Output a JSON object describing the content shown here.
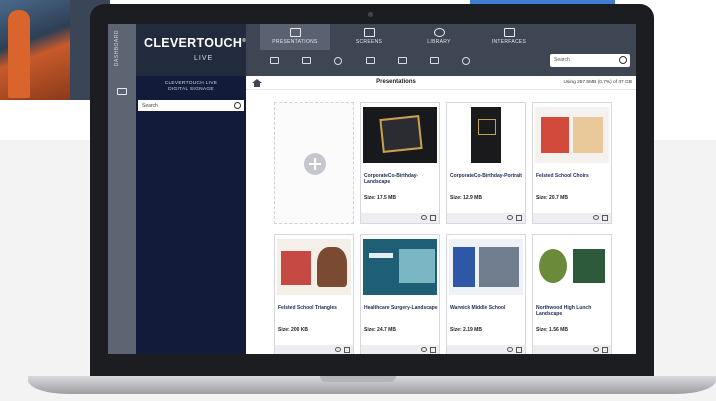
{
  "app": {
    "brand": "CLEVERTOUCH",
    "brand_mark": "®",
    "brand_sub": "LIVE",
    "vertical_label": "DASHBOARD"
  },
  "tabs": [
    {
      "label": "PRESENTATIONS",
      "active": true
    },
    {
      "label": "SCREENS",
      "active": false
    },
    {
      "label": "LIBRARY",
      "active": false
    },
    {
      "label": "INTERFACES",
      "active": false
    }
  ],
  "top_search": {
    "placeholder": "Search"
  },
  "panel": {
    "title_line1": "CLEVERTOUCH LIVE",
    "title_line2": "DIGITAL SIGNAGE",
    "search_placeholder": "Search"
  },
  "main": {
    "title": "Presentations",
    "usage": "Using 257.5MB (0.7%) of 37 GB"
  },
  "cards": [
    {
      "title": "CorporateCo-Birthday-Landscape",
      "size": "Size: 17.5 MB",
      "thumb": "birthday"
    },
    {
      "title": "CorporateCo-Birthday-Portrait",
      "size": "Size: 12.9 MB",
      "thumb": "portrait"
    },
    {
      "title": "Felsted School Choirs",
      "size": "Size: 20.7 MB",
      "thumb": "choirs"
    },
    {
      "title": "Felsted School Triangles",
      "size": "Size: 200 KB",
      "thumb": "triangles"
    },
    {
      "title": "Healthcare Surgery-Landscape",
      "size": "Size: 24.7 MB",
      "thumb": "healthcare"
    },
    {
      "title": "Warwick Middle School",
      "size": "Size: 2.19 MB",
      "thumb": "warwick"
    },
    {
      "title": "Northwood High Lunch Landscape",
      "size": "Size: 1.56 MB",
      "thumb": "lunch"
    }
  ],
  "colors": {
    "header": "#3e4654",
    "brand_bg": "#222a3d",
    "panel": "#121b3a",
    "card_title": "#1d2a55"
  }
}
